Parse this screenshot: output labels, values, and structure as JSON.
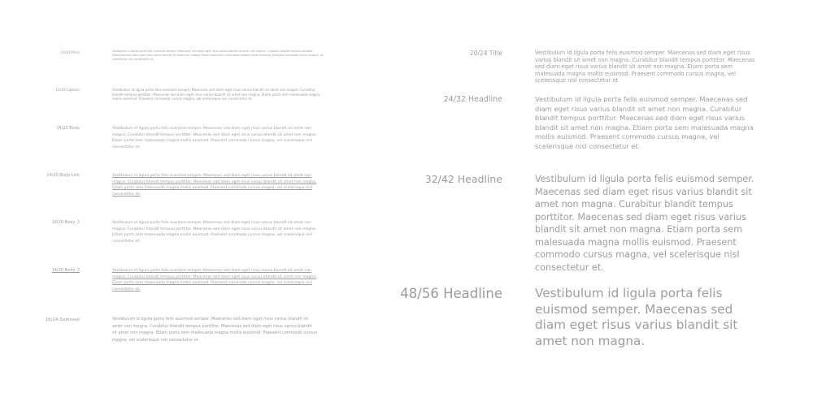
{
  "left": {
    "rows": [
      {
        "label": "10/14 Micro",
        "text": "Vestibulum id ligula porta felis euismod semper. Maecenas sed diam eget risus varius blandit sit amet non magna. Curabitur blandit tempus porttitor. Maecenas sed diam eget risus varius blandit sit amet non magna. Etiam porta sem malesuada magna mollis euismod. Praesent commodo cursus magna, vel scelerisque nisl consectetur et."
      },
      {
        "label": "12/16 Caption",
        "text": "Vestibulum id ligula porta felis euismod semper. Maecenas sed diam eget risus varius blandit sit amet non magna. Curabitur blandit tempus porttitor. Maecenas sed diam eget risus varius blandit sit amet non magna. Etiam porta sem malesuada magna mollis euismod. Praesent commodo cursus magna, vel scelerisque nisl consectetur et."
      },
      {
        "label": "14/20 Body",
        "text": "Vestibulum id ligula porta felis euismod semper. Maecenas sed diam eget risus varius blandit sit amet non magna. Curabitur blandit tempus porttitor. Maecenas sed diam eget risus varius blandit sit amet non magna. Etiam porta sem malesuada magna mollis euismod. Praesent commodo cursus magna, vel scelerisque nisl consectetur et."
      },
      {
        "label": "14/20 Body-Link",
        "text": "Vestibulum id ligula porta felis euismod semper. Maecenas sed diam eget risus varius blandit sit amet non magna. Curabitur blandit tempus porttitor. Maecenas sed diam eget risus varius blandit sit amet non magna. Etiam porta sem malesuada magna mollis euismod. Praesent commodo cursus magna, vel scelerisque nisl consectetur et."
      },
      {
        "label": "14/20 Body_2",
        "text": "Vestibulum id ligula porta felis euismod semper. Maecenas sed diam eget risus varius blandit sit amet non magna. Curabitur blandit tempus porttitor. Maecenas sed diam eget risus varius blandit sit amet non magna. Etiam porta sem malesuada magna mollis euismod. Praesent commodo cursus magna, vel scelerisque nisl consectetur et."
      },
      {
        "label": "14/20 Body_3",
        "text": "Vestibulum id ligula porta felis euismod semper. Maecenas sed diam eget risus varius blandit sit amet non magna. Curabitur blandit tempus porttitor. Maecenas sed diam eget risus varius blandit sit amet non magna. Etiam porta sem malesuada magna mollis euismod. Praesent commodo cursus magna, vel scelerisque nisl consectetur et."
      },
      {
        "label": "16/24 Subhead",
        "text": "Vestibulum id ligula porta felis euismod semper. Maecenas sed diam eget risus varius blandit sit amet non magna. Curabitur blandit tempus porttitor. Maecenas sed diam eget risus varius blandit sit amet non magna. Etiam porta sem malesuada magna mollis euismod. Praesent commodo cursus magna, vel scelerisque nisl consectetur et."
      }
    ]
  },
  "right": {
    "rows": [
      {
        "label": "20/24 Title",
        "text": "Vestibulum id ligula porta felis euismod semper. Maecenas sed diam eget risus varius blandit sit amet non magna. Curabitur blandit tempus porttitor. Maecenas sed diam eget risus varius blandit sit amet non magna. Etiam porta sem malesuada magna mollis euismod. Praesent commodo cursus magna, vel scelerisque nisl consectetur et."
      },
      {
        "label": "24/32 Headline",
        "text": "Vestibulum id ligula porta felis euismod semper. Maecenas sed diam eget risus varius blandit sit amet non magna. Curabitur blandit tempus porttitor. Maecenas sed diam eget risus varius blandit sit amet non magna. Etiam porta sem malesuada magna mollis euismod. Praesent commodo cursus magna, vel scelerisque nisl consectetur et."
      },
      {
        "label": "32/42 Headline",
        "text": "Vestibulum id ligula porta felis euismod semper. Maecenas sed diam eget risus varius blandit sit amet non magna. Curabitur blandit tempus porttitor. Maecenas sed diam eget risus varius blandit sit amet non magna. Etiam porta sem malesuada magna mollis euismod. Praesent commodo cursus magna, vel scelerisque nisl consectetur et."
      },
      {
        "label": "48/56 Headline",
        "text": "Vestibulum id ligula porta felis euismod semper. Maecenas sed diam eget risus varius blandit sit amet non magna."
      }
    ]
  }
}
